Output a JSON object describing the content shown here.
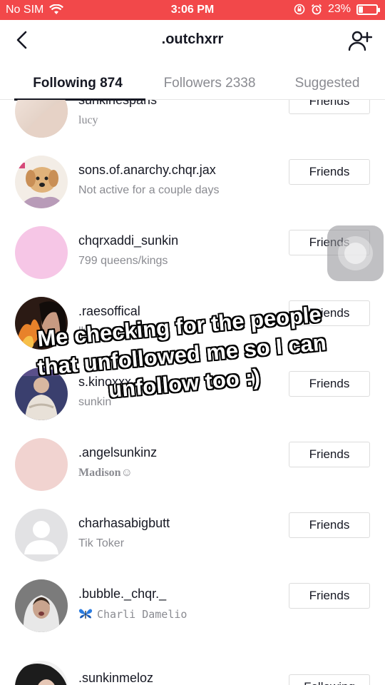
{
  "status_bar": {
    "carrier": "No SIM",
    "time": "3:06 PM",
    "battery": "23%",
    "battery_level": 0.23
  },
  "header": {
    "title": ".outchxrr"
  },
  "tabs": [
    {
      "label": "Following 874",
      "active": true
    },
    {
      "label": "Followers 2338",
      "active": false
    },
    {
      "label": "Suggested",
      "active": false
    }
  ],
  "rows": [
    {
      "username": "sunkinesparis",
      "subtitle": "lucy",
      "button": "Friends",
      "avatar_color": "#eadbd2"
    },
    {
      "username": "sons.of.anarchy.chqr.jax",
      "subtitle": "Not active for a couple days",
      "button": "Friends",
      "avatar_color": "#d9b48c"
    },
    {
      "username": "chqrxaddi_sunkin",
      "subtitle": "799 queens/kings",
      "button": "Friends",
      "avatar_color": "#f6c6e6"
    },
    {
      "username": ".raesoffical",
      "subtitle": "lly!",
      "button": "Friends",
      "avatar_color": "#8a4a2a"
    },
    {
      "username": "s.kinoxxx",
      "subtitle": "sunkin",
      "button": "Friends",
      "avatar_color": "#4a4f7a"
    },
    {
      "username": ".angelsunkinz",
      "subtitle": "Madison☺",
      "button": "Friends",
      "avatar_color": "#f1d3d0"
    },
    {
      "username": "charhasabigbutt",
      "subtitle": "Tik Toker",
      "button": "Friends",
      "avatar_color": "#e2e2e4"
    },
    {
      "username": ".bubble._chqr._",
      "subtitle": "Charli Damelio",
      "button": "Friends",
      "avatar_color": "#9c9c9c"
    },
    {
      "username": ".sunkinmeloz",
      "subtitle": "",
      "button": "Following",
      "avatar_color": "#2a2a2a"
    }
  ],
  "caption": "Me checking for the people that unfollowed me so I can unfollow too :)",
  "icons": {
    "back": "chevron-left-icon",
    "add_user": "add-user-icon",
    "wifi": "wifi-icon",
    "alarm": "alarm-icon",
    "lock_rotation": "rotation-lock-icon",
    "butterfly": "butterfly-icon"
  }
}
